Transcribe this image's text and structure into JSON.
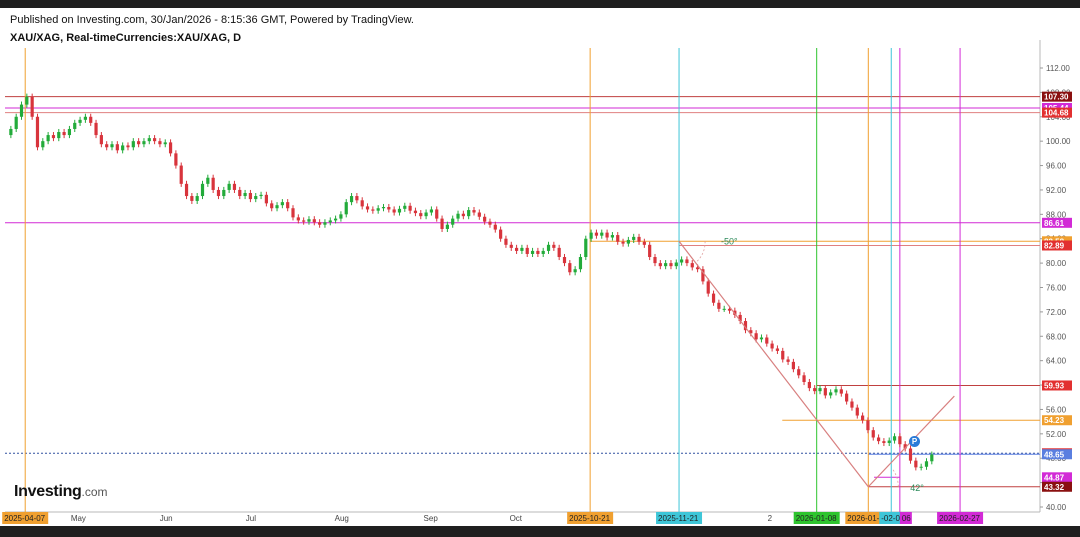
{
  "header": {
    "published": "Published on Investing.com, 30/Jan/2026 - 8:15:36 GMT, Powered by TradingView.",
    "symbol": "XAU/XAG, Real-timeCurrencies:XAU/XAG, D"
  },
  "logo": {
    "brand": "Investing",
    "suffix": ".com"
  },
  "colors": {
    "up": "#22ab3a",
    "down": "#d8343c",
    "magenta": "#d22ad6",
    "orange": "#f0a030",
    "cyan": "#3ec6d8",
    "green": "#2ec42e",
    "salmon": "#e08080",
    "darkred": "#8a1010",
    "red": "#e23030"
  },
  "chart_data": {
    "type": "candlestick",
    "title": "XAU/XAG",
    "timeframe": "D",
    "ylim": [
      40,
      114
    ],
    "y_ticks": [
      "112.00",
      "108.00",
      "104.00",
      "100.00",
      "96.00",
      "92.00",
      "88.00",
      "84.00",
      "80.00",
      "76.00",
      "72.00",
      "68.00",
      "64.00",
      "60.00",
      "56.00",
      "52.00",
      "48.00",
      "44.00",
      "40.00"
    ],
    "y_tick_values": [
      112,
      108,
      104,
      100,
      96,
      92,
      88,
      84,
      80,
      76,
      72,
      68,
      64,
      60,
      56,
      52,
      48,
      44,
      40
    ],
    "x_months": [
      "May",
      "Jun",
      "Jul",
      "Aug",
      "Sep",
      "Oct",
      "Nov",
      "ec",
      "2"
    ],
    "x_month_days": [
      24,
      55,
      85,
      116,
      147,
      177,
      208,
      238,
      267
    ],
    "x_range_days": [
      0,
      325
    ],
    "x_start_date": "2025-04-01",
    "series_closes": [
      102,
      104,
      106,
      107.3,
      104,
      99,
      100,
      101,
      100.5,
      101.5,
      101,
      102,
      103,
      103.5,
      104,
      103,
      101,
      99.5,
      99,
      99.5,
      98.5,
      99.3,
      99,
      100,
      99.5,
      100,
      100.5,
      100,
      99.5,
      99.8,
      98,
      96,
      93,
      91,
      90.2,
      91,
      93,
      94,
      92,
      91,
      92,
      93,
      92,
      91,
      91.5,
      90.5,
      91,
      91.2,
      89.8,
      89,
      89.5,
      90,
      89,
      87.5,
      87,
      86.8,
      87.2,
      86.7,
      86.3,
      86.7,
      87,
      87.3,
      88,
      90,
      91,
      90.3,
      89.3,
      88.8,
      88.6,
      89,
      89.2,
      88.8,
      88.3,
      88.9,
      89.4,
      88.6,
      88.2,
      87.7,
      88.3,
      88.8,
      87.3,
      85.6,
      86.3,
      87.3,
      88.1,
      87.7,
      88.7,
      88.3,
      87.6,
      86.8,
      86.3,
      85.5,
      84,
      83,
      82.5,
      82,
      82.5,
      81.5,
      82,
      81.5,
      82,
      83,
      82.5,
      81,
      80,
      78.5,
      79,
      81,
      84,
      85,
      84.5,
      85,
      84.2,
      84.6,
      83.5,
      83.2,
      83.8,
      84.3,
      83.5,
      83,
      81,
      80,
      79.5,
      80,
      79.5,
      80.1,
      80.6,
      80,
      79.3,
      79,
      77,
      75,
      73.5,
      72.5,
      72.5,
      72.2,
      71.5,
      70.5,
      69,
      68.5,
      67.5,
      67.8,
      66.8,
      66,
      65.6,
      64.2,
      63.8,
      62.6,
      61.6,
      60.5,
      59.5,
      59,
      59.5,
      58.3,
      58.8,
      59.3,
      58.6,
      57.3,
      56.3,
      55,
      54.2,
      52.6,
      51.4,
      50.8,
      50.5,
      50.9,
      51.6,
      50.3,
      49.6,
      47.6,
      46.5,
      46.6,
      47.5,
      48.6
    ],
    "dates_shown": [
      "2025-04-07",
      "2025-10-21",
      "2025-11-21",
      "2026-01-08",
      "2026-01-26",
      "2026-02-03",
      "2026-02-06",
      "2026-02-27"
    ],
    "vertical_lines": [
      {
        "label": "2025-04-07",
        "day": 6,
        "color": "#f0a030"
      },
      {
        "label": "2025-10-21",
        "day": 203,
        "color": "#f0a030"
      },
      {
        "label": "2025-11-21",
        "day": 234,
        "color": "#3ec6d8"
      },
      {
        "label": "2026-01-08",
        "day": 282,
        "color": "#2ec42e"
      },
      {
        "label": "2026-01-26",
        "day": 300,
        "color": "#f0a030"
      },
      {
        "label": "2026-02-03",
        "day": 308,
        "color": "#3ec6d8"
      },
      {
        "label": "2026-02-06",
        "day": 311,
        "color": "#d22ad6"
      },
      {
        "label": "2026-02-27",
        "day": 332,
        "color": "#d22ad6"
      }
    ],
    "horizontal_levels": [
      {
        "value": 107.3,
        "label": "107.30",
        "color": "#c04040",
        "badge": "#8a1010"
      },
      {
        "value": 105.44,
        "label": "105.44",
        "color": "#d22ad6",
        "badge": "#d22ad6"
      },
      {
        "value": 104.68,
        "label": "104.68",
        "color": "#e08080",
        "badge": "#e23030"
      },
      {
        "value": 86.61,
        "label": "86.61",
        "color": "#d22ad6",
        "badge": "#d22ad6"
      },
      {
        "value": 83.58,
        "label": "83.58",
        "color": "#f0a030",
        "badge": "#f0a030"
      },
      {
        "value": 82.89,
        "label": "82.89",
        "color": "#e08080",
        "badge": "#e23030"
      },
      {
        "value": 59.93,
        "label": "59.93",
        "color": "#c04040",
        "badge": "#e23030"
      },
      {
        "value": 54.23,
        "label": "54.23",
        "color": "#f0a030",
        "badge": "#f0a030"
      },
      {
        "value": 48.81,
        "label": "48.81",
        "color": "#3050a0",
        "badge": "#e23030"
      },
      {
        "value": 48.65,
        "label": "48.65",
        "color": "#5a7fe0",
        "badge": "#5a7fe0"
      },
      {
        "value": 44.87,
        "label": "44.87",
        "color": "#d22ad6",
        "badge": "#d22ad6"
      },
      {
        "value": 43.32,
        "label": "43.32",
        "color": "#c04040",
        "badge": "#8a1010"
      }
    ],
    "annotations": [
      "-50°",
      "42°"
    ],
    "marker": "P"
  }
}
